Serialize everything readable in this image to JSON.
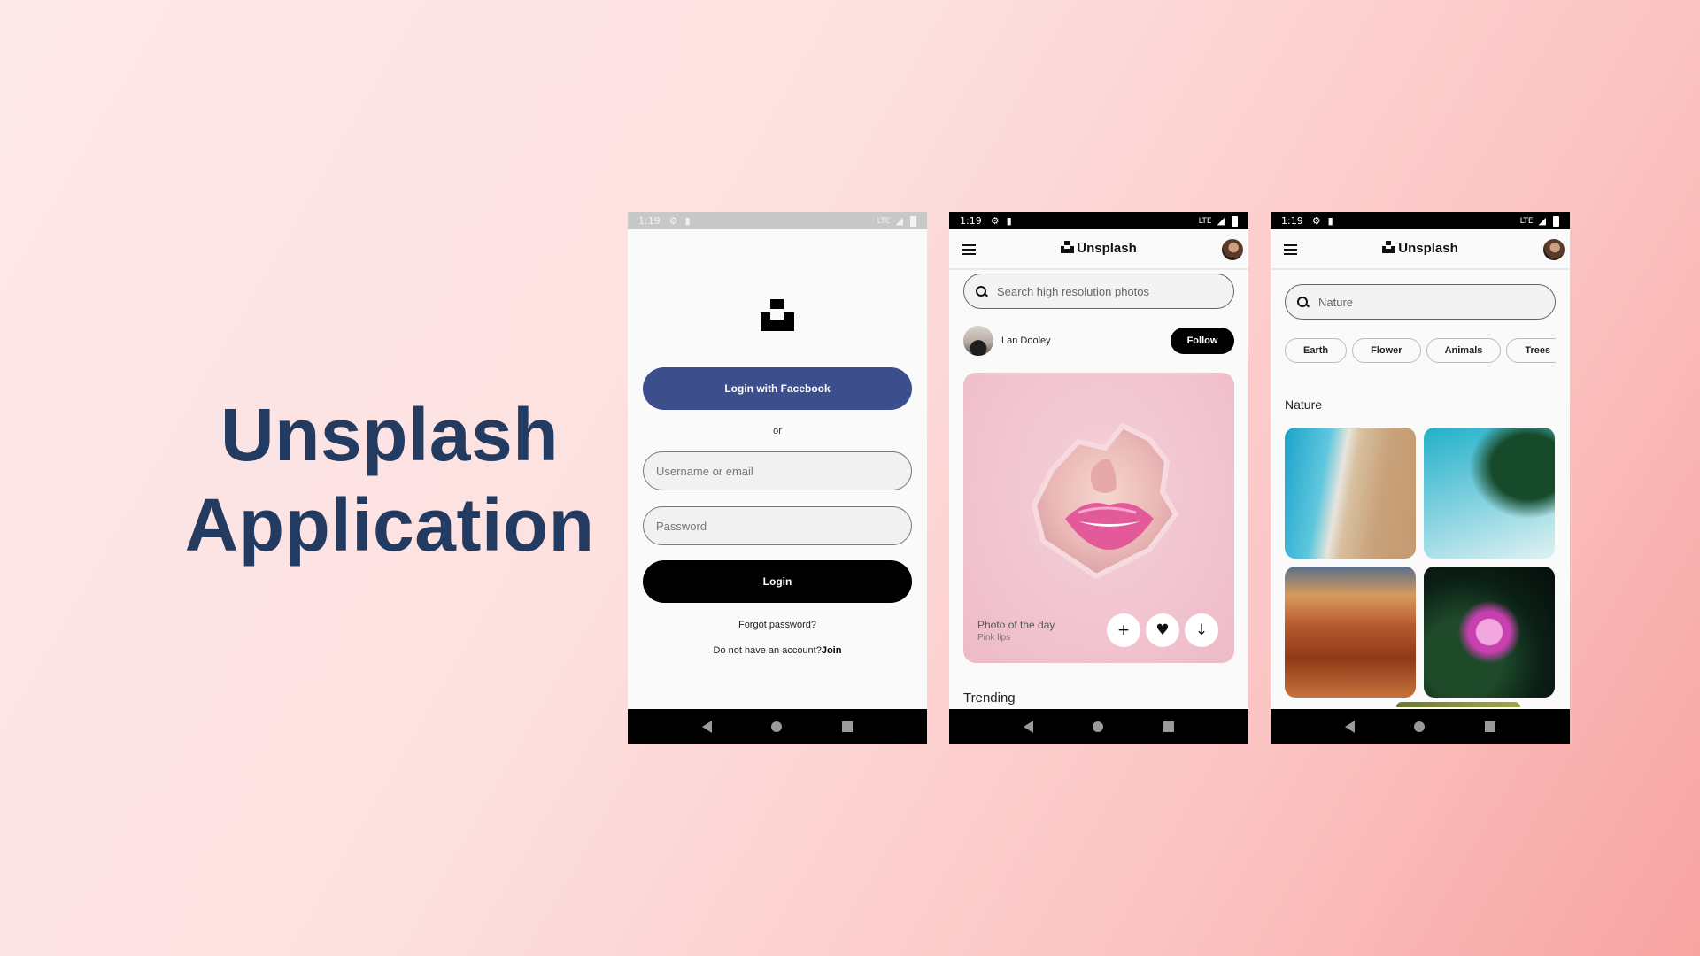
{
  "hero": {
    "line1": "Unsplash",
    "line2": "Application"
  },
  "status": {
    "time": "1:19",
    "network": "LTE"
  },
  "login": {
    "facebook_button": "Login with Facebook",
    "or_text": "or",
    "username_placeholder": "Username or email",
    "password_placeholder": "Password",
    "login_button": "Login",
    "forgot_password": "Forgot password?",
    "no_account_text": "Do not have an account?",
    "join_link": "Join"
  },
  "appbar": {
    "brand": "Unsplash"
  },
  "home": {
    "search_placeholder": "Search high resolution photos",
    "author_name": "Lan Dooley",
    "follow_button": "Follow",
    "card_title": "Photo of the day",
    "card_subtitle": "Pink lips",
    "add_glyph": "+",
    "like_glyph": "♥",
    "download_glyph": "↓",
    "trending_label": "Trending"
  },
  "search": {
    "query": "Nature",
    "chips": [
      "Earth",
      "Flower",
      "Animals",
      "Trees"
    ],
    "section_title": "Nature",
    "tiles": [
      "beach",
      "palm",
      "canyon",
      "lotus"
    ]
  },
  "colors": {
    "hero_text": "#243b61",
    "facebook_blue": "#3c4f8c",
    "primary_black": "#000000"
  }
}
